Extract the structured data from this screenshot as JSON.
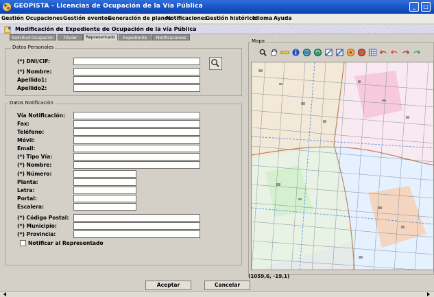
{
  "window": {
    "title": "GEOPISTA - Licencias de Ocupación de la Vía Pública"
  },
  "menu": [
    "Gestión Ocupaciones",
    "Gestión eventos",
    "Generación de planos",
    "Notificaciones",
    "Gestión histórico",
    "Idioma",
    "Ayuda"
  ],
  "panel": {
    "title": "Modificación de Expediente de Ocupación de la vía Pública"
  },
  "tabs": [
    "Solicitud Ocupación",
    "Titular",
    "Representado",
    "Expediente",
    "Notificaciones"
  ],
  "active_tab": "Representado",
  "personal": {
    "legend": "Datos Personales",
    "labels": [
      "(*) DNI/CIF:",
      "(*) Nombre:",
      "Apellido1:",
      "Apellido2:"
    ],
    "values": [
      "",
      "",
      "",
      ""
    ]
  },
  "notificacion": {
    "legend": "Datos Notificación",
    "labels": [
      "Vía Notificación:",
      "Fax:",
      "Teléfono:",
      "Móvil:",
      "Email:",
      "(*) Tipo Vía:",
      "(*) Nombre:",
      "(*) Número:",
      "Planta:",
      "Letra:",
      "Portal:",
      "Escalera:",
      "(*) Código Postal:",
      "(*) Municipio:",
      "(*) Provincia:"
    ],
    "values": [
      "",
      "",
      "",
      "",
      "",
      "",
      "",
      "",
      "",
      "",
      "",
      "",
      "",
      "",
      ""
    ]
  },
  "checkbox": {
    "label": "Notificar al Representado",
    "checked": false
  },
  "map": {
    "legend": "Mapa",
    "coords": "(1059,6, -19,1)"
  },
  "tools": [
    "zoom-icon",
    "hand-pan-icon",
    "ruler-icon",
    "info-icon",
    "globe-icon",
    "globe-refresh-icon",
    "edit-polygon-icon",
    "edit-polygon-blue-icon",
    "target-icon",
    "target-red-icon",
    "grid-icon",
    "arrow-back-icon",
    "arrow-back-red-icon",
    "arrow-forward-icon",
    "arrow-forward-green-icon"
  ],
  "buttons": {
    "accept": "Aceptar",
    "cancel": "Cancelar"
  }
}
